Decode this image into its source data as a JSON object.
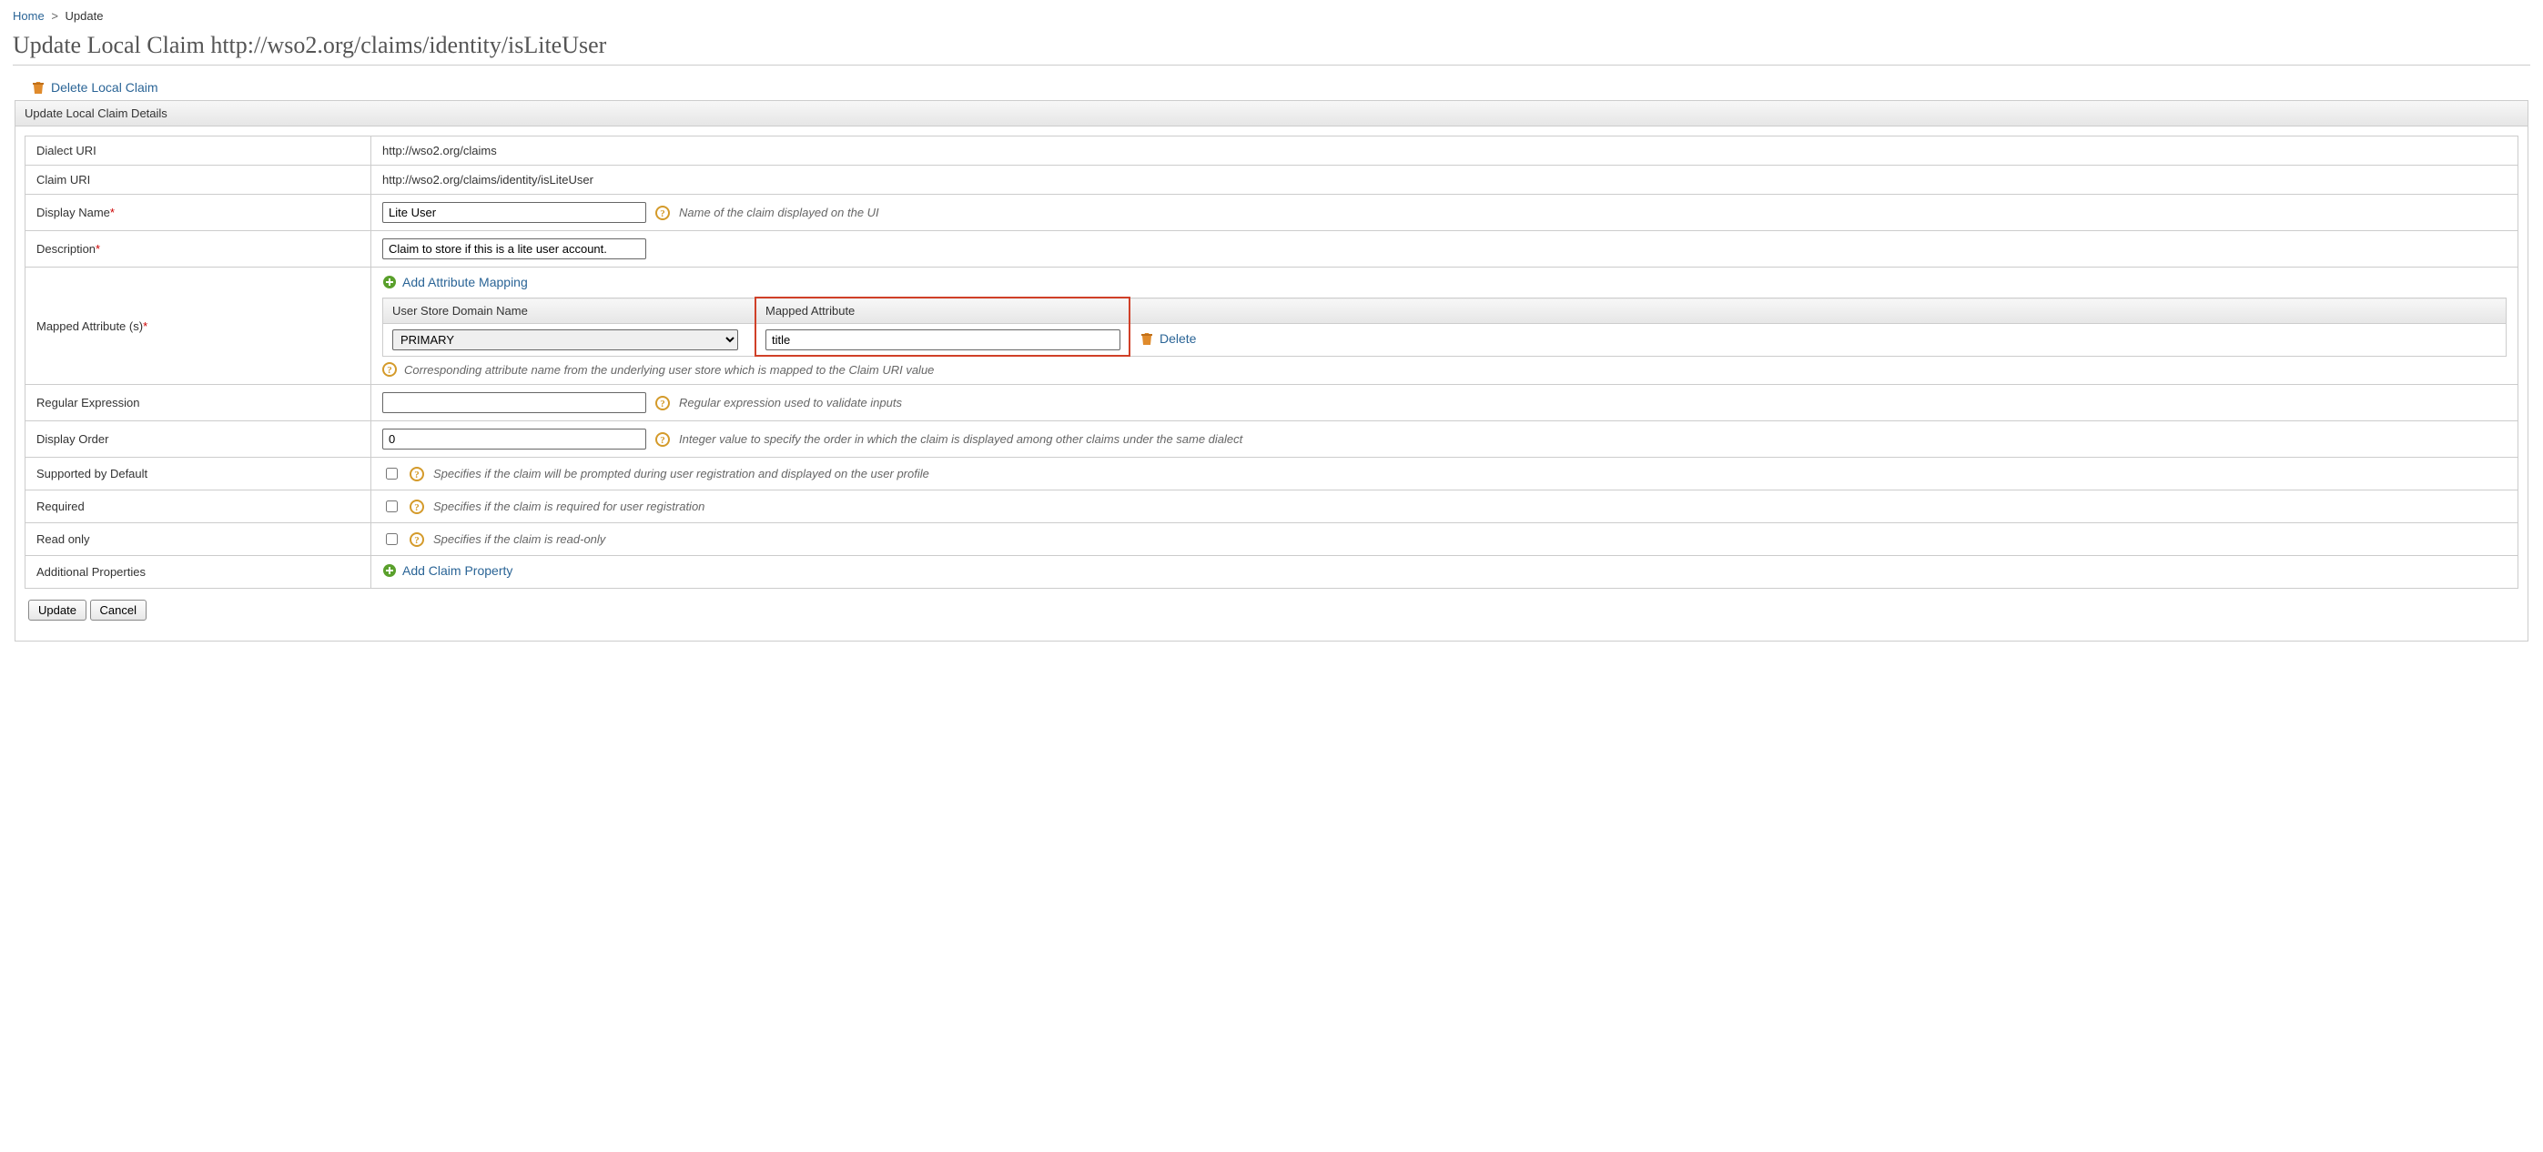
{
  "breadcrumb": {
    "home": "Home",
    "current": "Update"
  },
  "page": {
    "title": "Update Local Claim http://wso2.org/claims/identity/isLiteUser"
  },
  "actions": {
    "delete_claim": "Delete Local Claim",
    "add_mapping": "Add Attribute Mapping",
    "add_property": "Add Claim Property",
    "delete_mapping": "Delete"
  },
  "panel": {
    "header": "Update Local Claim Details"
  },
  "labels": {
    "dialect_uri": "Dialect URI",
    "claim_uri": "Claim URI",
    "display_name": "Display Name",
    "description": "Description",
    "mapped_attr": "Mapped Attribute (s)",
    "regex": "Regular Expression",
    "display_order": "Display Order",
    "supported": "Supported by Default",
    "required": "Required",
    "readonly": "Read only",
    "additional": "Additional Properties"
  },
  "values": {
    "dialect_uri": "http://wso2.org/claims",
    "claim_uri": "http://wso2.org/claims/identity/isLiteUser",
    "display_name": "Lite User",
    "description": "Claim to store if this is a lite user account.",
    "regex": "",
    "display_order": "0"
  },
  "hints": {
    "display_name": "Name of the claim displayed on the UI",
    "mapped_attr": "Corresponding attribute name from the underlying user store which is mapped to the Claim URI value",
    "regex": "Regular expression used to validate inputs",
    "display_order": "Integer value to specify the order in which the claim is displayed among other claims under the same dialect",
    "supported": "Specifies if the claim will be prompted during user registration and displayed on the user profile",
    "required": "Specifies if the claim is required for user registration",
    "readonly": "Specifies if the claim is read-only"
  },
  "mapping": {
    "headers": {
      "domain": "User Store Domain Name",
      "attribute": "Mapped Attribute"
    },
    "rows": [
      {
        "domain": "PRIMARY",
        "attribute": "title"
      }
    ]
  },
  "buttons": {
    "update": "Update",
    "cancel": "Cancel"
  }
}
